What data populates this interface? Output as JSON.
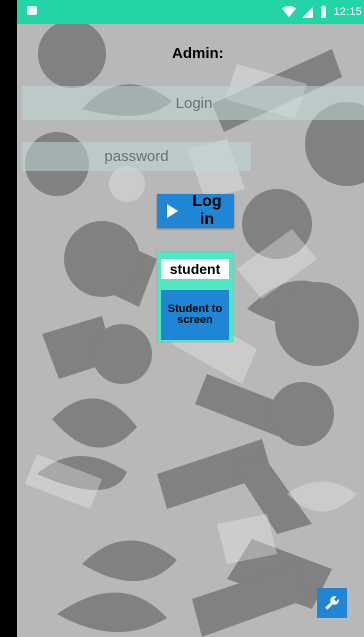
{
  "status_bar": {
    "time": "12:15",
    "icons": [
      "notification-icon",
      "wifi-icon",
      "signal-icon",
      "battery-icon"
    ],
    "color": "#23d5a6"
  },
  "header": {
    "title": "Admin:"
  },
  "form": {
    "login_placeholder": "Login",
    "password_placeholder": "password",
    "login_button_label": "Log in"
  },
  "student": {
    "input_value": "student",
    "button_label": "Student to screen"
  },
  "fab": {
    "icon": "wrench-icon"
  },
  "colors": {
    "accent": "#1f86d6",
    "student_card": "#4fe8c3"
  }
}
